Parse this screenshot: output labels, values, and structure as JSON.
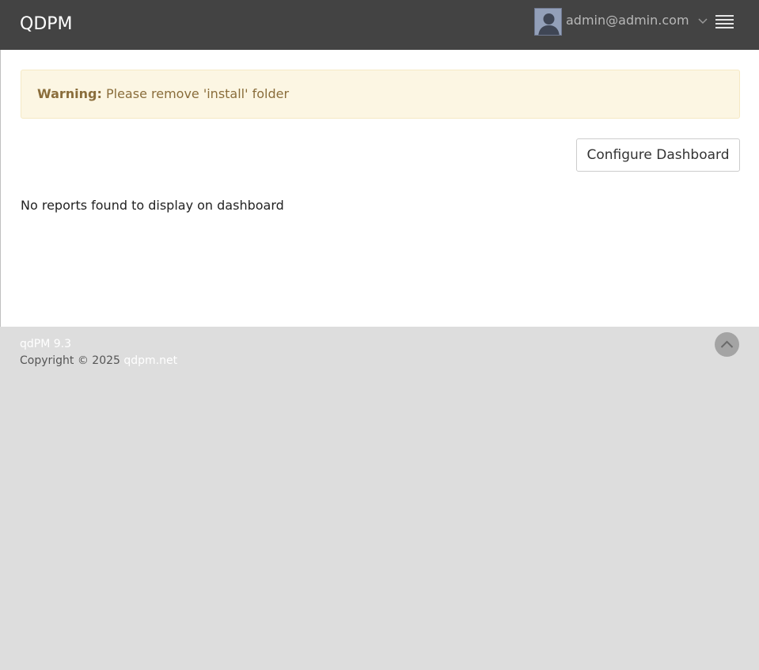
{
  "header": {
    "brand": "QDPM",
    "user_email": "admin@admin.com",
    "avatar_icon": "user-avatar-icon",
    "dropdown_icon": "chevron-down-icon",
    "menu_icon": "hamburger-menu-icon"
  },
  "alert": {
    "label": "Warning:",
    "message": "Please remove 'install' folder"
  },
  "main": {
    "configure_button": "Configure Dashboard",
    "empty_message": "No reports found to display on dashboard"
  },
  "footer": {
    "version": "qdPM 9.3",
    "copyright": "Copyright © 2025",
    "site_link": "qdpm.net",
    "scroll_top_icon": "chevron-up-icon"
  },
  "colors": {
    "header_bg": "#434343",
    "alert_bg": "#fcf6e3",
    "alert_text": "#8a6d3b",
    "footer_bg": "#dddddd"
  }
}
